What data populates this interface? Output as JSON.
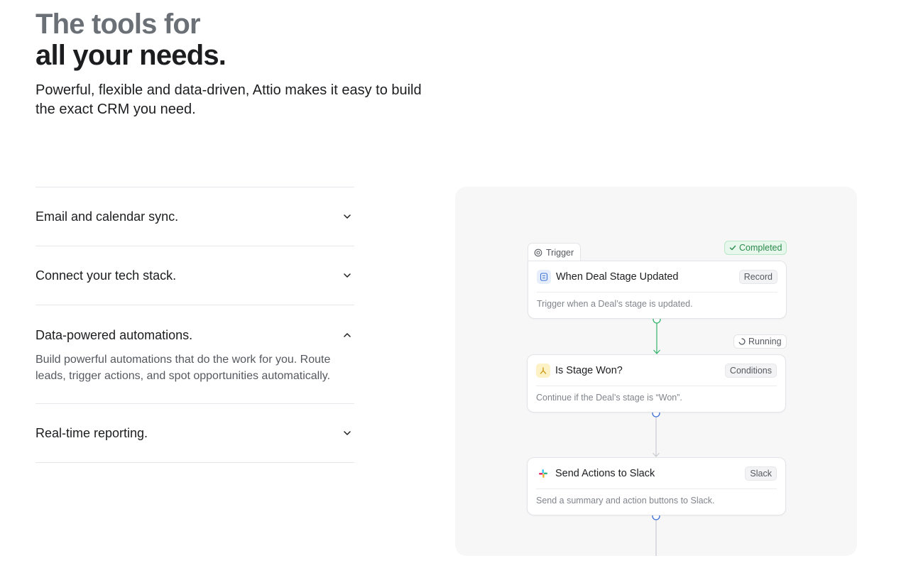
{
  "hero": {
    "title_line1": "The tools for",
    "title_line2": "all your needs.",
    "subtitle": "Powerful, flexible and data-driven, Attio makes it easy to build the exact CRM you need."
  },
  "features": [
    {
      "title": "Email and calendar sync.",
      "expanded": false,
      "icon": "chevron-down-icon"
    },
    {
      "title": "Connect your tech stack.",
      "expanded": false,
      "icon": "chevron-down-icon"
    },
    {
      "title": "Data-powered automations.",
      "expanded": true,
      "icon": "chevron-up-icon",
      "description": "Build powerful automations that do the work for you. Route leads, trigger actions, and spot opportunities automatically."
    },
    {
      "title": "Real-time reporting.",
      "expanded": false,
      "icon": "chevron-down-icon"
    }
  ],
  "workflow": {
    "trigger_tab": "Trigger",
    "nodes": [
      {
        "title": "When Deal Stage Updated",
        "tag": "Record",
        "description": "Trigger when a Deal’s stage is updated.",
        "status": "Completed",
        "icon": "record-icon"
      },
      {
        "title": "Is Stage Won?",
        "tag": "Conditions",
        "description": "Continue if the Deal’s stage is “Won”.",
        "status": "Running",
        "icon": "conditions-icon"
      },
      {
        "title": "Send Actions to Slack",
        "tag": "Slack",
        "description": "Send a summary and action buttons to Slack.",
        "icon": "slack-icon"
      }
    ]
  },
  "colors": {
    "success": "#2a8a4c",
    "connector_active": "#34b46a",
    "connector_idle": "#c9cbcf",
    "node_dot": "#3b6fd4",
    "panel_bg": "#f7f7f8"
  }
}
